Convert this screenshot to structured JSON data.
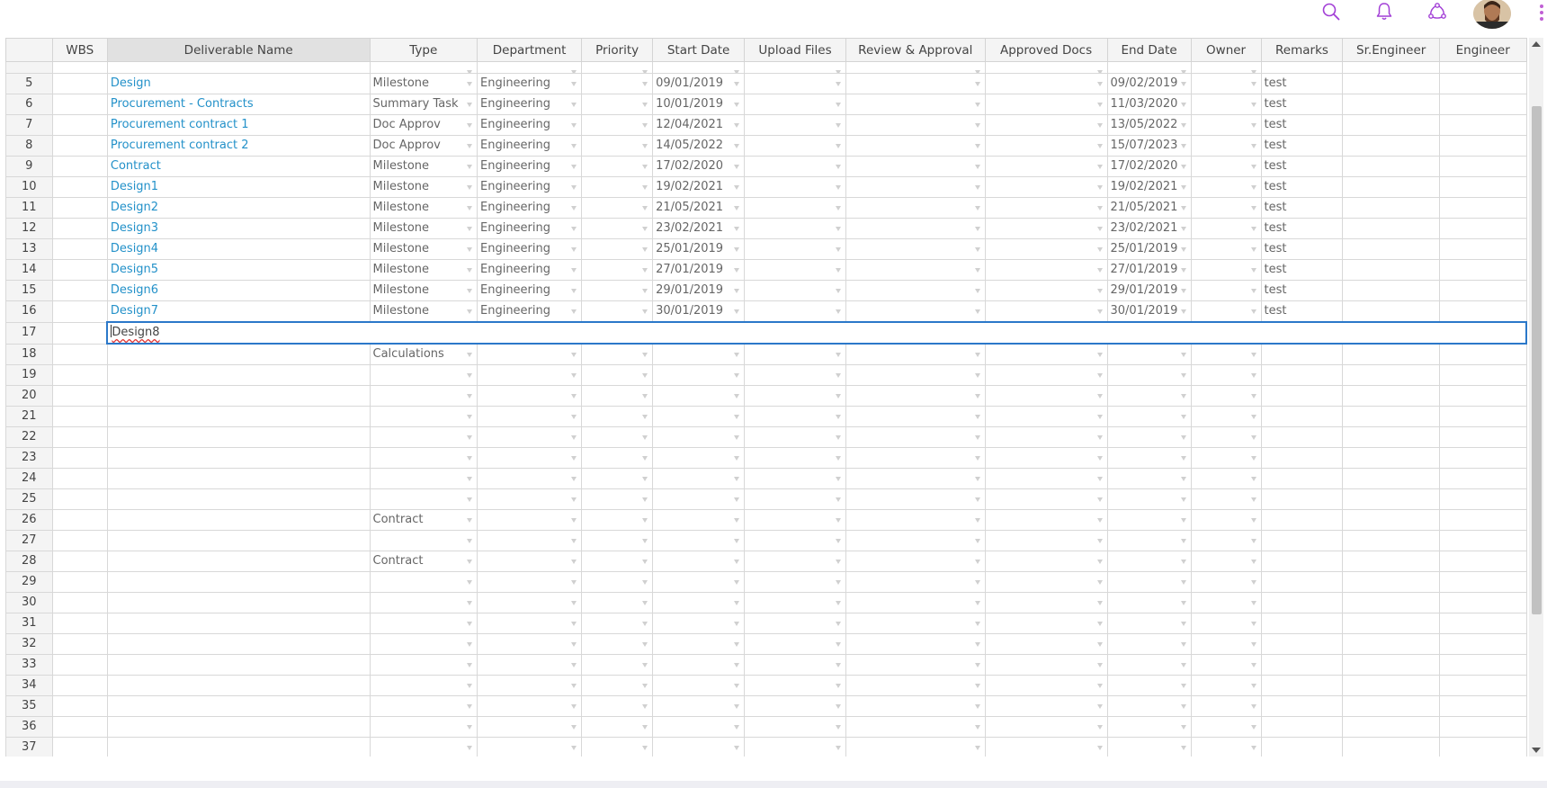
{
  "topbar": {
    "icons": [
      {
        "name": "search-icon"
      },
      {
        "name": "bell-icon"
      },
      {
        "name": "share-icon"
      }
    ],
    "accent": "#a23fd6"
  },
  "grid": {
    "columns": [
      "",
      "WBS",
      "Deliverable Name",
      "Type",
      "Department",
      "Priority",
      "Start Date",
      "Upload Files",
      "Review & Approval",
      "Approved Docs",
      "End Date",
      "Owner",
      "Remarks",
      "Sr.Engineer",
      "Engineer"
    ],
    "rows": [
      {
        "n": "5",
        "wbs": "",
        "name": "Design",
        "type": "Milestone",
        "dept": "Engineering",
        "priority": "",
        "start": "09/01/2019",
        "upload": "",
        "review": "",
        "approved": "",
        "end": "09/02/2019",
        "owner": "",
        "remarks": "test",
        "sr": "",
        "eng": ""
      },
      {
        "n": "6",
        "wbs": "",
        "name": "Procurement - Contracts",
        "type": "Summary Task",
        "dept": "Engineering",
        "priority": "",
        "start": "10/01/2019",
        "upload": "",
        "review": "",
        "approved": "",
        "end": "11/03/2020",
        "owner": "",
        "remarks": "test",
        "sr": "",
        "eng": ""
      },
      {
        "n": "7",
        "wbs": "",
        "name": "Procurement contract 1",
        "type": "Doc Approv",
        "dept": "Engineering",
        "priority": "",
        "start": "12/04/2021",
        "upload": "",
        "review": "",
        "approved": "",
        "end": "13/05/2022",
        "owner": "",
        "remarks": "test",
        "sr": "",
        "eng": ""
      },
      {
        "n": "8",
        "wbs": "",
        "name": "Procurement contract 2",
        "type": "Doc Approv",
        "dept": "Engineering",
        "priority": "",
        "start": "14/05/2022",
        "upload": "",
        "review": "",
        "approved": "",
        "end": "15/07/2023",
        "owner": "",
        "remarks": "test",
        "sr": "",
        "eng": ""
      },
      {
        "n": "9",
        "wbs": "",
        "name": "Contract",
        "type": "Milestone",
        "dept": "Engineering",
        "priority": "",
        "start": "17/02/2020",
        "upload": "",
        "review": "",
        "approved": "",
        "end": "17/02/2020",
        "owner": "",
        "remarks": "test",
        "sr": "",
        "eng": ""
      },
      {
        "n": "10",
        "wbs": "",
        "name": "Design1",
        "type": "Milestone",
        "dept": "Engineering",
        "priority": "",
        "start": "19/02/2021",
        "upload": "",
        "review": "",
        "approved": "",
        "end": "19/02/2021",
        "owner": "",
        "remarks": "test",
        "sr": "",
        "eng": ""
      },
      {
        "n": "11",
        "wbs": "",
        "name": "Design2",
        "type": "Milestone",
        "dept": "Engineering",
        "priority": "",
        "start": "21/05/2021",
        "upload": "",
        "review": "",
        "approved": "",
        "end": "21/05/2021",
        "owner": "",
        "remarks": "test",
        "sr": "",
        "eng": ""
      },
      {
        "n": "12",
        "wbs": "",
        "name": "Design3",
        "type": "Milestone",
        "dept": "Engineering",
        "priority": "",
        "start": "23/02/2021",
        "upload": "",
        "review": "",
        "approved": "",
        "end": "23/02/2021",
        "owner": "",
        "remarks": "test",
        "sr": "",
        "eng": ""
      },
      {
        "n": "13",
        "wbs": "",
        "name": "Design4",
        "type": "Milestone",
        "dept": "Engineering",
        "priority": "",
        "start": "25/01/2019",
        "upload": "",
        "review": "",
        "approved": "",
        "end": "25/01/2019",
        "owner": "",
        "remarks": "test",
        "sr": "",
        "eng": ""
      },
      {
        "n": "14",
        "wbs": "",
        "name": "Design5",
        "type": "Milestone",
        "dept": "Engineering",
        "priority": "",
        "start": "27/01/2019",
        "upload": "",
        "review": "",
        "approved": "",
        "end": "27/01/2019",
        "owner": "",
        "remarks": "test",
        "sr": "",
        "eng": ""
      },
      {
        "n": "15",
        "wbs": "",
        "name": "Design6",
        "type": "Milestone",
        "dept": "Engineering",
        "priority": "",
        "start": "29/01/2019",
        "upload": "",
        "review": "",
        "approved": "",
        "end": "29/01/2019",
        "owner": "",
        "remarks": "test",
        "sr": "",
        "eng": ""
      },
      {
        "n": "16",
        "wbs": "",
        "name": "Design7",
        "type": "Milestone",
        "dept": "Engineering",
        "priority": "",
        "start": "30/01/2019",
        "upload": "",
        "review": "",
        "approved": "",
        "end": "30/01/2019",
        "owner": "",
        "remarks": "test",
        "sr": "",
        "eng": ""
      }
    ],
    "editing_row": {
      "n": "17",
      "value": "Design8"
    },
    "blank_rows": [
      {
        "n": "18",
        "type": "Calculations"
      },
      {
        "n": "19",
        "type": ""
      },
      {
        "n": "20",
        "type": ""
      },
      {
        "n": "21",
        "type": ""
      },
      {
        "n": "22",
        "type": ""
      },
      {
        "n": "23",
        "type": ""
      },
      {
        "n": "24",
        "type": ""
      },
      {
        "n": "25",
        "type": ""
      },
      {
        "n": "26",
        "type": "Contract"
      },
      {
        "n": "27",
        "type": ""
      },
      {
        "n": "28",
        "type": "Contract"
      },
      {
        "n": "29",
        "type": ""
      },
      {
        "n": "30",
        "type": ""
      },
      {
        "n": "31",
        "type": ""
      },
      {
        "n": "32",
        "type": ""
      },
      {
        "n": "33",
        "type": ""
      },
      {
        "n": "34",
        "type": ""
      },
      {
        "n": "35",
        "type": ""
      },
      {
        "n": "36",
        "type": ""
      },
      {
        "n": "37",
        "type": ""
      }
    ]
  }
}
